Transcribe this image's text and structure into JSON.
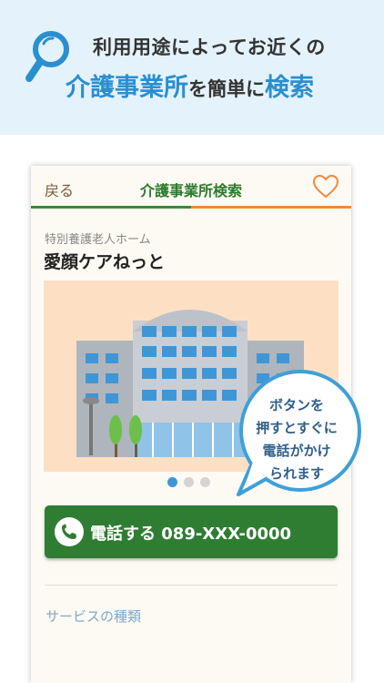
{
  "hero": {
    "line1": "利用用途によってお近くの",
    "line2_part1": "介護事業所",
    "line2_part2": "を簡単に",
    "line2_part3": "検索",
    "accent_color": "#2a8fd0",
    "icon": "magnifier-icon"
  },
  "nav": {
    "back_label": "戻る",
    "title": "介護事業所検索",
    "favorite_icon": "heart-icon"
  },
  "facility": {
    "category": "特別養護老人ホーム",
    "name": "愛顔ケアねっと",
    "photo_page": 1,
    "photo_count": 3
  },
  "call_button": {
    "label": "電話する 089-XXX-0000",
    "icon": "phone-icon",
    "color": "#2f7d32"
  },
  "tooltip": {
    "lines": [
      "ボタンを",
      "押すとすぐに",
      "電話がかけ",
      "られます"
    ]
  },
  "sections": {
    "service_type": "サービスの種類"
  }
}
